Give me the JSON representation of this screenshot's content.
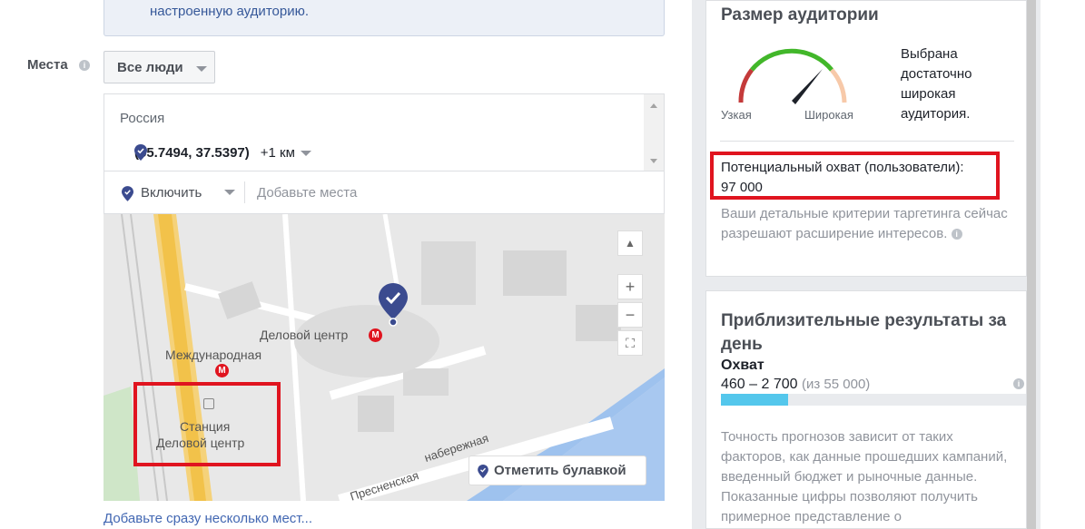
{
  "notice": {
    "text": "настроенную аудиторию."
  },
  "places": {
    "label": "Места",
    "audience_select": "Все люди",
    "country": "Россия",
    "coords": "(55.7494, 37.5397)",
    "radius": "+1 км",
    "include_select": "Включить",
    "add_places_placeholder": "Добавьте места",
    "add_multiple_link": "Добавьте сразу несколько мест..."
  },
  "map": {
    "labels": {
      "business_center": "Деловой центр",
      "international": "Международная",
      "station_line1": "Станция",
      "station_line2": "Деловой центр",
      "embankment1": "Пресненская",
      "embankment2": "набережная"
    },
    "metro_symbol": "M",
    "zoom_in": "+",
    "zoom_out": "−",
    "drop_pin_button": "Отметить булавкой"
  },
  "audience_size": {
    "title": "Размер аудитории",
    "gauge_narrow": "Узкая",
    "gauge_wide": "Широкая",
    "status": "Выбрана достаточно широкая аудитория.",
    "potential_reach_label": "Потенциальный охват (пользователи):",
    "potential_reach_value": "97 000",
    "expansion_note": "Ваши детальные критерии таргетинга сейчас разрешают расширение интересов."
  },
  "daily_results": {
    "title": "Приблизительные результаты за день",
    "reach_label": "Охват",
    "reach_range": "460 – 2 700",
    "reach_total": "(из 55 000)",
    "reach_bar_fraction": 0.22,
    "accuracy_note": "Точность прогнозов зависит от таких факторов, как данные прошедших кампаний, введенный бюджет и рыночные данные. Показанные цифры позволяют получить примерное представление о"
  },
  "colors": {
    "accent_blue": "#4267b2",
    "pin_blue": "#3b4b8f",
    "highlight_red": "#e0141f",
    "bar_cyan": "#54c7ec"
  }
}
